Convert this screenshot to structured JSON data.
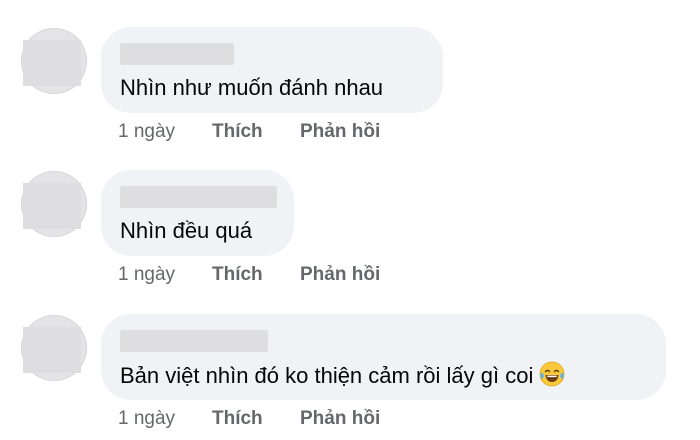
{
  "comments": [
    {
      "text": "Nhìn như muốn đánh nhau",
      "time": "1 ngày",
      "like_label": "Thích",
      "reply_label": "Phản hồi"
    },
    {
      "text": "Nhìn đều quá",
      "time": "1 ngày",
      "like_label": "Thích",
      "reply_label": "Phản hồi"
    },
    {
      "text": "Bản việt nhìn đó ko thiện cảm rồi lấy gì coi",
      "emoji": "face-with-tears-of-joy-icon",
      "time": "1 ngày",
      "like_label": "Thích",
      "reply_label": "Phản hồi"
    }
  ],
  "colors": {
    "bubble": "#f0f2f5",
    "action_text": "#65676b",
    "comment_text": "#050505",
    "redaction": "#dedee0"
  }
}
